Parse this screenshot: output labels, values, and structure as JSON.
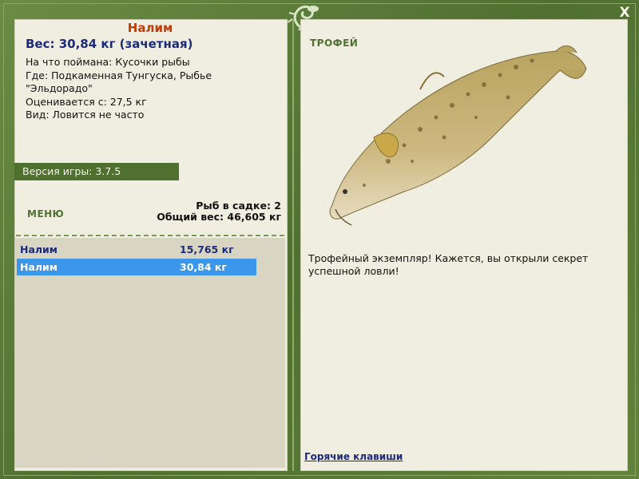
{
  "window": {
    "close_label": "X"
  },
  "catch": {
    "fish_name": "Налим",
    "weight_line": "Вес: 30,84 кг (зачетная)",
    "details": [
      "На что поймана: Кусочки рыбы",
      "Где: Подкаменная Тунгуска, Рыбье \"Эльдорадо\"",
      "Оценивается с: 27,5 кг",
      "Вид: Ловится не часто"
    ]
  },
  "version_label": "Версия игры: 3.7.5",
  "menu_label": "МЕНЮ",
  "keepnet": {
    "count_line": "Рыб в садке: 2",
    "total_line": "Общий вес: 46,605 кг",
    "items": [
      {
        "name": "Налим",
        "weight": "15,765 кг"
      },
      {
        "name": "Налим",
        "weight": "30,84 кг"
      }
    ]
  },
  "trophy_label": "ТРОФЕЙ",
  "trophy_text": "Трофейный экземпляр! Кажется, вы открыли секрет успешной ловли!",
  "hotkeys_label": "Горячие клавиши",
  "colors": {
    "accent_green": "#50702f",
    "selected_row": "#3a97ec",
    "title_orange": "#c03d0a",
    "navy": "#1d2a7a"
  }
}
